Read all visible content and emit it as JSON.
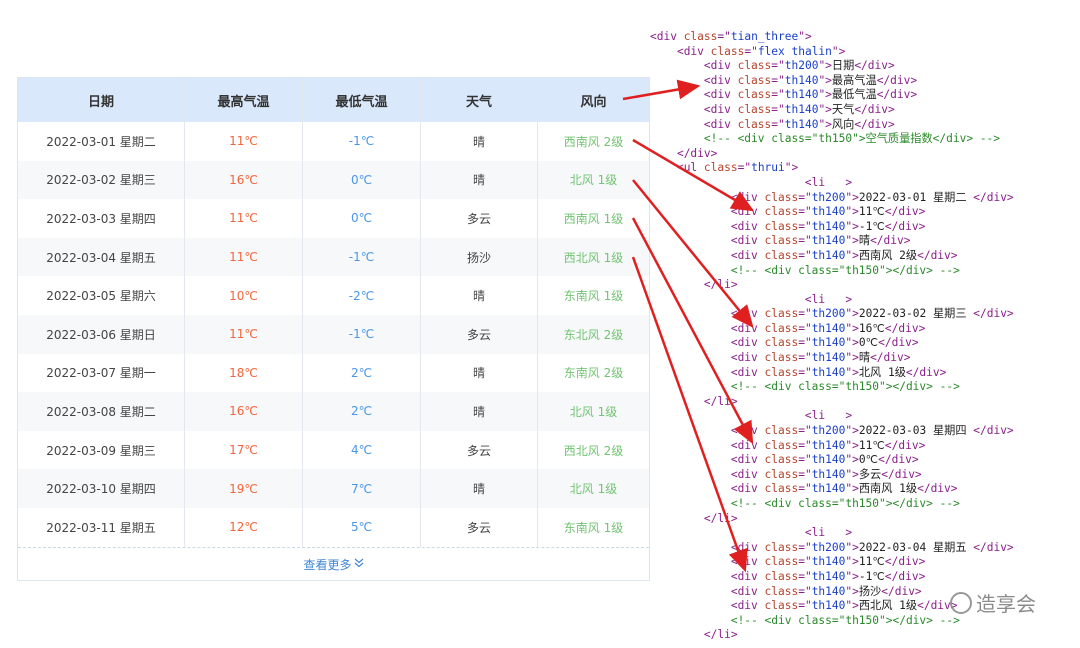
{
  "table": {
    "headers": [
      "日期",
      "最高气温",
      "最低气温",
      "天气",
      "风向"
    ],
    "rows": [
      {
        "date": "2022-03-01 星期二",
        "high": "11℃",
        "low": "-1℃",
        "weather": "晴",
        "wind": "西南风 2级"
      },
      {
        "date": "2022-03-02 星期三",
        "high": "16℃",
        "low": "0℃",
        "weather": "晴",
        "wind": "北风 1级"
      },
      {
        "date": "2022-03-03 星期四",
        "high": "11℃",
        "low": "0℃",
        "weather": "多云",
        "wind": "西南风 1级"
      },
      {
        "date": "2022-03-04 星期五",
        "high": "11℃",
        "low": "-1℃",
        "weather": "扬沙",
        "wind": "西北风 1级"
      },
      {
        "date": "2022-03-05 星期六",
        "high": "10℃",
        "low": "-2℃",
        "weather": "晴",
        "wind": "东南风 1级"
      },
      {
        "date": "2022-03-06 星期日",
        "high": "11℃",
        "low": "-1℃",
        "weather": "多云",
        "wind": "东北风 2级"
      },
      {
        "date": "2022-03-07 星期一",
        "high": "18℃",
        "low": "2℃",
        "weather": "晴",
        "wind": "东南风 2级"
      },
      {
        "date": "2022-03-08 星期二",
        "high": "16℃",
        "low": "2℃",
        "weather": "晴",
        "wind": "北风 1级"
      },
      {
        "date": "2022-03-09 星期三",
        "high": "17℃",
        "low": "4℃",
        "weather": "多云",
        "wind": "西北风 2级"
      },
      {
        "date": "2022-03-10 星期四",
        "high": "19℃",
        "low": "7℃",
        "weather": "晴",
        "wind": "北风 1级"
      },
      {
        "date": "2022-03-11 星期五",
        "high": "12℃",
        "low": "5℃",
        "weather": "多云",
        "wind": "东南风 1级"
      }
    ],
    "more_label": "查看更多",
    "more_icon": "double-chevron-down-icon"
  },
  "code_lines": [
    [
      [
        "tag",
        "<div "
      ],
      [
        "attr",
        "class"
      ],
      [
        "tag",
        "=\""
      ],
      [
        "val",
        "tian_three"
      ],
      [
        "tag",
        "\">"
      ]
    ],
    [
      [
        "txt",
        "    "
      ],
      [
        "tag",
        "<div "
      ],
      [
        "attr",
        "class"
      ],
      [
        "tag",
        "=\""
      ],
      [
        "val",
        "flex thalin"
      ],
      [
        "tag",
        "\">"
      ]
    ],
    [
      [
        "txt",
        "        "
      ],
      [
        "tag",
        "<div "
      ],
      [
        "attr",
        "class"
      ],
      [
        "tag",
        "=\""
      ],
      [
        "val",
        "th200"
      ],
      [
        "tag",
        "\">"
      ],
      [
        "txt",
        "日期"
      ],
      [
        "tag",
        "</div>"
      ]
    ],
    [
      [
        "txt",
        "        "
      ],
      [
        "tag",
        "<div "
      ],
      [
        "attr",
        "class"
      ],
      [
        "tag",
        "=\""
      ],
      [
        "val",
        "th140"
      ],
      [
        "tag",
        "\">"
      ],
      [
        "txt",
        "最高气温"
      ],
      [
        "tag",
        "</div>"
      ]
    ],
    [
      [
        "txt",
        "        "
      ],
      [
        "tag",
        "<div "
      ],
      [
        "attr",
        "class"
      ],
      [
        "tag",
        "=\""
      ],
      [
        "val",
        "th140"
      ],
      [
        "tag",
        "\">"
      ],
      [
        "txt",
        "最低气温"
      ],
      [
        "tag",
        "</div>"
      ]
    ],
    [
      [
        "txt",
        "        "
      ],
      [
        "tag",
        "<div "
      ],
      [
        "attr",
        "class"
      ],
      [
        "tag",
        "=\""
      ],
      [
        "val",
        "th140"
      ],
      [
        "tag",
        "\">"
      ],
      [
        "txt",
        "天气"
      ],
      [
        "tag",
        "</div>"
      ]
    ],
    [
      [
        "txt",
        "        "
      ],
      [
        "tag",
        "<div "
      ],
      [
        "attr",
        "class"
      ],
      [
        "tag",
        "=\""
      ],
      [
        "val",
        "th140"
      ],
      [
        "tag",
        "\">"
      ],
      [
        "txt",
        "风向"
      ],
      [
        "tag",
        "</div>"
      ]
    ],
    [
      [
        "txt",
        "        "
      ],
      [
        "cmt",
        "<!-- <div class=\"th150\">空气质量指数</div> -->"
      ]
    ],
    [
      [
        "txt",
        "    "
      ],
      [
        "tag",
        "</div>"
      ]
    ],
    [
      [
        "txt",
        "    "
      ],
      [
        "tag",
        "<ul "
      ],
      [
        "attr",
        "class"
      ],
      [
        "tag",
        "=\""
      ],
      [
        "val",
        "thrui"
      ],
      [
        "tag",
        "\">"
      ]
    ],
    [
      [
        "txt",
        "                       "
      ],
      [
        "tag",
        "<li   >"
      ]
    ],
    [
      [
        "txt",
        "            "
      ],
      [
        "tag",
        "<div "
      ],
      [
        "attr",
        "class"
      ],
      [
        "tag",
        "=\""
      ],
      [
        "val",
        "th200"
      ],
      [
        "tag",
        "\">"
      ],
      [
        "txt",
        "2022-03-01 星期二 "
      ],
      [
        "tag",
        "</div>"
      ]
    ],
    [
      [
        "txt",
        "            "
      ],
      [
        "tag",
        "<div "
      ],
      [
        "attr",
        "class"
      ],
      [
        "tag",
        "=\""
      ],
      [
        "val",
        "th140"
      ],
      [
        "tag",
        "\">"
      ],
      [
        "txt",
        "11℃"
      ],
      [
        "tag",
        "</div>"
      ]
    ],
    [
      [
        "txt",
        "            "
      ],
      [
        "tag",
        "<div "
      ],
      [
        "attr",
        "class"
      ],
      [
        "tag",
        "=\""
      ],
      [
        "val",
        "th140"
      ],
      [
        "tag",
        "\">"
      ],
      [
        "txt",
        "-1℃"
      ],
      [
        "tag",
        "</div>"
      ]
    ],
    [
      [
        "txt",
        "            "
      ],
      [
        "tag",
        "<div "
      ],
      [
        "attr",
        "class"
      ],
      [
        "tag",
        "=\""
      ],
      [
        "val",
        "th140"
      ],
      [
        "tag",
        "\">"
      ],
      [
        "txt",
        "晴"
      ],
      [
        "tag",
        "</div>"
      ]
    ],
    [
      [
        "txt",
        "            "
      ],
      [
        "tag",
        "<div "
      ],
      [
        "attr",
        "class"
      ],
      [
        "tag",
        "=\""
      ],
      [
        "val",
        "th140"
      ],
      [
        "tag",
        "\">"
      ],
      [
        "txt",
        "西南风 2级"
      ],
      [
        "tag",
        "</div>"
      ]
    ],
    [
      [
        "txt",
        "            "
      ],
      [
        "cmt",
        "<!-- <div class=\"th150\"></div> -->"
      ]
    ],
    [
      [
        "txt",
        "        "
      ],
      [
        "tag",
        "</li>"
      ]
    ],
    [
      [
        "txt",
        "                       "
      ],
      [
        "tag",
        "<li   >"
      ]
    ],
    [
      [
        "txt",
        "            "
      ],
      [
        "tag",
        "<div "
      ],
      [
        "attr",
        "class"
      ],
      [
        "tag",
        "=\""
      ],
      [
        "val",
        "th200"
      ],
      [
        "tag",
        "\">"
      ],
      [
        "txt",
        "2022-03-02 星期三 "
      ],
      [
        "tag",
        "</div>"
      ]
    ],
    [
      [
        "txt",
        "            "
      ],
      [
        "tag",
        "<div "
      ],
      [
        "attr",
        "class"
      ],
      [
        "tag",
        "=\""
      ],
      [
        "val",
        "th140"
      ],
      [
        "tag",
        "\">"
      ],
      [
        "txt",
        "16℃"
      ],
      [
        "tag",
        "</div>"
      ]
    ],
    [
      [
        "txt",
        "            "
      ],
      [
        "tag",
        "<div "
      ],
      [
        "attr",
        "class"
      ],
      [
        "tag",
        "=\""
      ],
      [
        "val",
        "th140"
      ],
      [
        "tag",
        "\">"
      ],
      [
        "txt",
        "0℃"
      ],
      [
        "tag",
        "</div>"
      ]
    ],
    [
      [
        "txt",
        "            "
      ],
      [
        "tag",
        "<div "
      ],
      [
        "attr",
        "class"
      ],
      [
        "tag",
        "=\""
      ],
      [
        "val",
        "th140"
      ],
      [
        "tag",
        "\">"
      ],
      [
        "txt",
        "晴"
      ],
      [
        "tag",
        "</div>"
      ]
    ],
    [
      [
        "txt",
        "            "
      ],
      [
        "tag",
        "<div "
      ],
      [
        "attr",
        "class"
      ],
      [
        "tag",
        "=\""
      ],
      [
        "val",
        "th140"
      ],
      [
        "tag",
        "\">"
      ],
      [
        "txt",
        "北风 1级"
      ],
      [
        "tag",
        "</div>"
      ]
    ],
    [
      [
        "txt",
        "            "
      ],
      [
        "cmt",
        "<!-- <div class=\"th150\"></div> -->"
      ]
    ],
    [
      [
        "txt",
        "        "
      ],
      [
        "tag",
        "</li>"
      ]
    ],
    [
      [
        "txt",
        "                       "
      ],
      [
        "tag",
        "<li   >"
      ]
    ],
    [
      [
        "txt",
        "            "
      ],
      [
        "tag",
        "<div "
      ],
      [
        "attr",
        "class"
      ],
      [
        "tag",
        "=\""
      ],
      [
        "val",
        "th200"
      ],
      [
        "tag",
        "\">"
      ],
      [
        "txt",
        "2022-03-03 星期四 "
      ],
      [
        "tag",
        "</div>"
      ]
    ],
    [
      [
        "txt",
        "            "
      ],
      [
        "tag",
        "<div "
      ],
      [
        "attr",
        "class"
      ],
      [
        "tag",
        "=\""
      ],
      [
        "val",
        "th140"
      ],
      [
        "tag",
        "\">"
      ],
      [
        "txt",
        "11℃"
      ],
      [
        "tag",
        "</div>"
      ]
    ],
    [
      [
        "txt",
        "            "
      ],
      [
        "tag",
        "<div "
      ],
      [
        "attr",
        "class"
      ],
      [
        "tag",
        "=\""
      ],
      [
        "val",
        "th140"
      ],
      [
        "tag",
        "\">"
      ],
      [
        "txt",
        "0℃"
      ],
      [
        "tag",
        "</div>"
      ]
    ],
    [
      [
        "txt",
        "            "
      ],
      [
        "tag",
        "<div "
      ],
      [
        "attr",
        "class"
      ],
      [
        "tag",
        "=\""
      ],
      [
        "val",
        "th140"
      ],
      [
        "tag",
        "\">"
      ],
      [
        "txt",
        "多云"
      ],
      [
        "tag",
        "</div>"
      ]
    ],
    [
      [
        "txt",
        "            "
      ],
      [
        "tag",
        "<div "
      ],
      [
        "attr",
        "class"
      ],
      [
        "tag",
        "=\""
      ],
      [
        "val",
        "th140"
      ],
      [
        "tag",
        "\">"
      ],
      [
        "txt",
        "西南风 1级"
      ],
      [
        "tag",
        "</div>"
      ]
    ],
    [
      [
        "txt",
        "            "
      ],
      [
        "cmt",
        "<!-- <div class=\"th150\"></div> -->"
      ]
    ],
    [
      [
        "txt",
        "        "
      ],
      [
        "tag",
        "</li>"
      ]
    ],
    [
      [
        "txt",
        "                       "
      ],
      [
        "tag",
        "<li   >"
      ]
    ],
    [
      [
        "txt",
        "            "
      ],
      [
        "tag",
        "<div "
      ],
      [
        "attr",
        "class"
      ],
      [
        "tag",
        "=\""
      ],
      [
        "val",
        "th200"
      ],
      [
        "tag",
        "\">"
      ],
      [
        "txt",
        "2022-03-04 星期五 "
      ],
      [
        "tag",
        "</div>"
      ]
    ],
    [
      [
        "txt",
        "            "
      ],
      [
        "tag",
        "<div "
      ],
      [
        "attr",
        "class"
      ],
      [
        "tag",
        "=\""
      ],
      [
        "val",
        "th140"
      ],
      [
        "tag",
        "\">"
      ],
      [
        "txt",
        "11℃"
      ],
      [
        "tag",
        "</div>"
      ]
    ],
    [
      [
        "txt",
        "            "
      ],
      [
        "tag",
        "<div "
      ],
      [
        "attr",
        "class"
      ],
      [
        "tag",
        "=\""
      ],
      [
        "val",
        "th140"
      ],
      [
        "tag",
        "\">"
      ],
      [
        "txt",
        "-1℃"
      ],
      [
        "tag",
        "</div>"
      ]
    ],
    [
      [
        "txt",
        "            "
      ],
      [
        "tag",
        "<div "
      ],
      [
        "attr",
        "class"
      ],
      [
        "tag",
        "=\""
      ],
      [
        "val",
        "th140"
      ],
      [
        "tag",
        "\">"
      ],
      [
        "txt",
        "扬沙"
      ],
      [
        "tag",
        "</div>"
      ]
    ],
    [
      [
        "txt",
        "            "
      ],
      [
        "tag",
        "<div "
      ],
      [
        "attr",
        "class"
      ],
      [
        "tag",
        "=\""
      ],
      [
        "val",
        "th140"
      ],
      [
        "tag",
        "\">"
      ],
      [
        "txt",
        "西北风 1级"
      ],
      [
        "tag",
        "</div>"
      ]
    ],
    [
      [
        "txt",
        "            "
      ],
      [
        "cmt",
        "<!-- <div class=\"th150\"></div> -->"
      ]
    ],
    [
      [
        "txt",
        "        "
      ],
      [
        "tag",
        "</li>"
      ]
    ]
  ],
  "watermark": "造享会",
  "colors": {
    "header_bg": "#d9e8fb",
    "high_temp": "#f2643c",
    "low_temp": "#4a96e8",
    "wind": "#72c472",
    "arrow": "#e02020"
  }
}
